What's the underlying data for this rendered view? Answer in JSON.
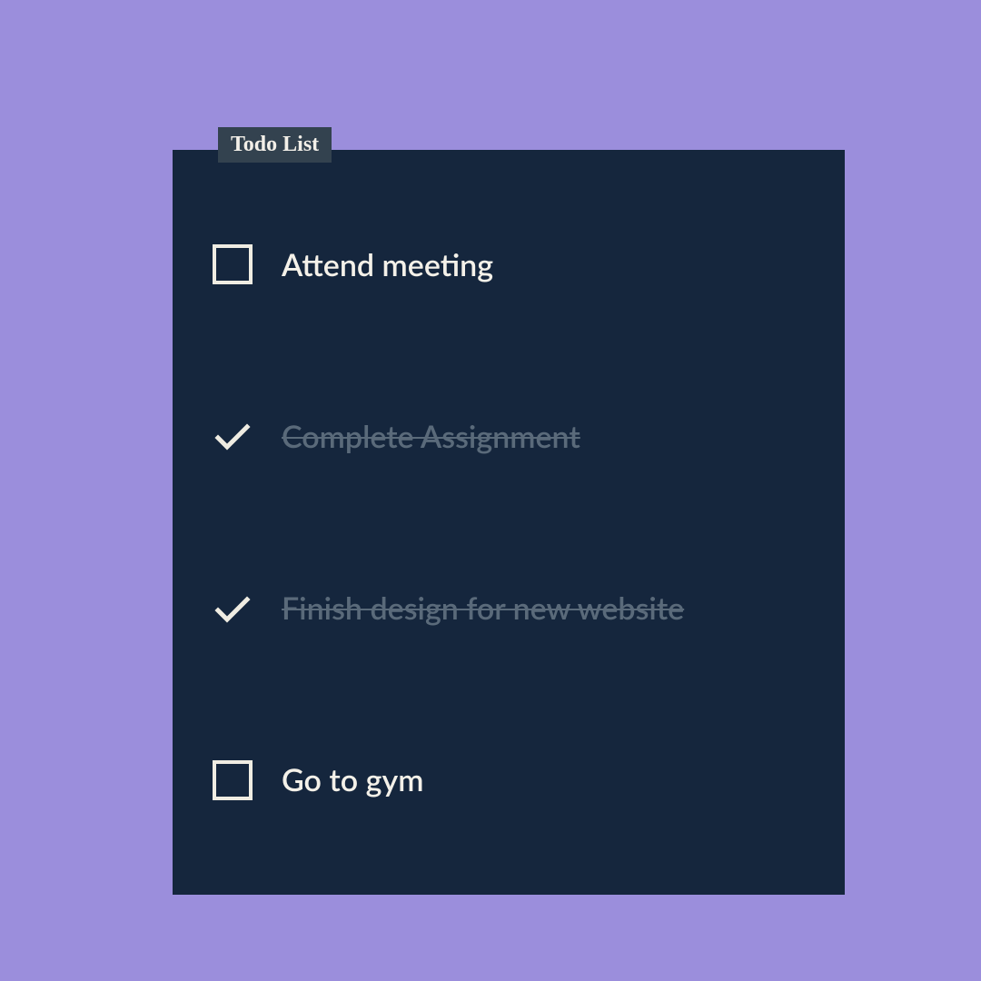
{
  "title": "Todo List",
  "items": [
    {
      "label": "Attend meeting",
      "done": false
    },
    {
      "label": "Complete Assignment",
      "done": true
    },
    {
      "label": "Finish design for new website",
      "done": true
    },
    {
      "label": "Go to gym",
      "done": false
    }
  ]
}
